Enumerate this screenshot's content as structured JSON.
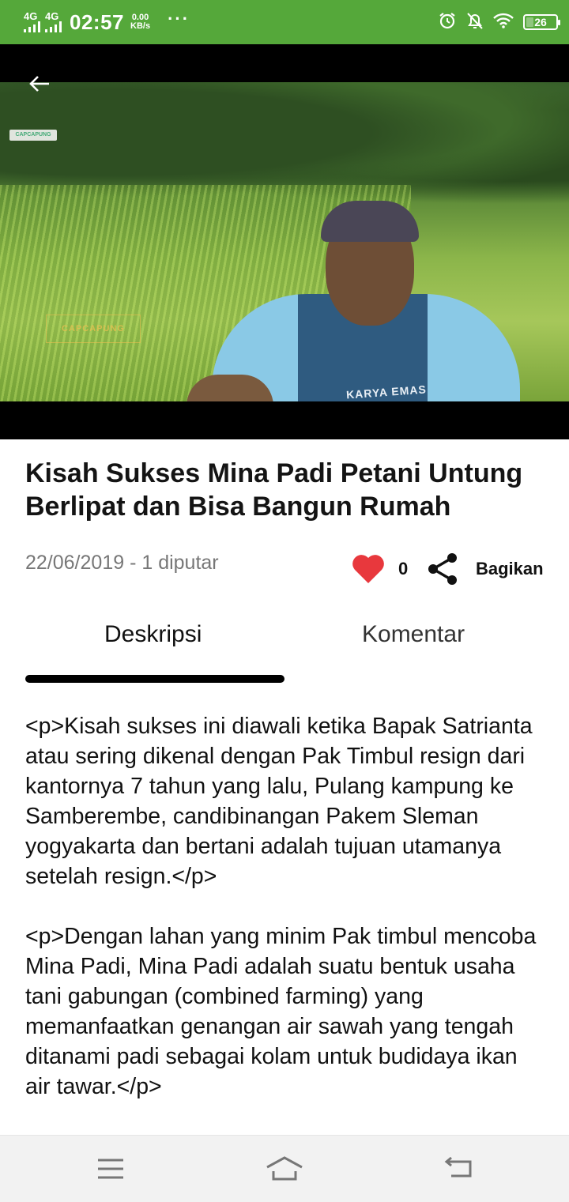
{
  "status_bar": {
    "network_1": "4G",
    "network_2": "4G",
    "time": "02:57",
    "speed_value": "0.00",
    "speed_unit": "KB/s",
    "more": "···",
    "battery": "26",
    "battery_level": 0.26,
    "icons": [
      "alarm-icon",
      "bell-off-icon",
      "wifi-icon",
      "battery-icon"
    ]
  },
  "video": {
    "channel_logo": "CAPCAPUNG",
    "watermark": "CAPCAPUNG",
    "shirt_text": "KARYA EMAS"
  },
  "article": {
    "title": "Kisah Sukses Mina Padi Petani Untung Berlipat dan Bisa Bangun Rumah",
    "meta": "22/06/2019 - 1 diputar",
    "like_count": "0",
    "share_label": "Bagikan"
  },
  "tabs": {
    "description": "Deskripsi",
    "comments": "Komentar",
    "active": "description"
  },
  "description": {
    "paragraphs": [
      "<p>Kisah sukses ini diawali ketika Bapak Satrianta atau sering dikenal dengan Pak Timbul resign dari kantornya 7 tahun yang lalu, Pulang kampung ke Samberembe, candibinangan Pakem Sleman yogyakarta dan bertani adalah tujuan utamanya setelah resign.</p>",
      "<p>Dengan lahan yang minim Pak timbul mencoba Mina Padi, Mina Padi adalah suatu bentuk usaha tani gabungan (combined farming) yang memanfaatkan genangan air sawah yang tengah ditanami padi sebagai kolam untuk budidaya ikan air tawar.</p>"
    ]
  },
  "colors": {
    "status_bar": "#55a83a",
    "heart": "#e8383d",
    "tab_indicator": "#000000"
  }
}
